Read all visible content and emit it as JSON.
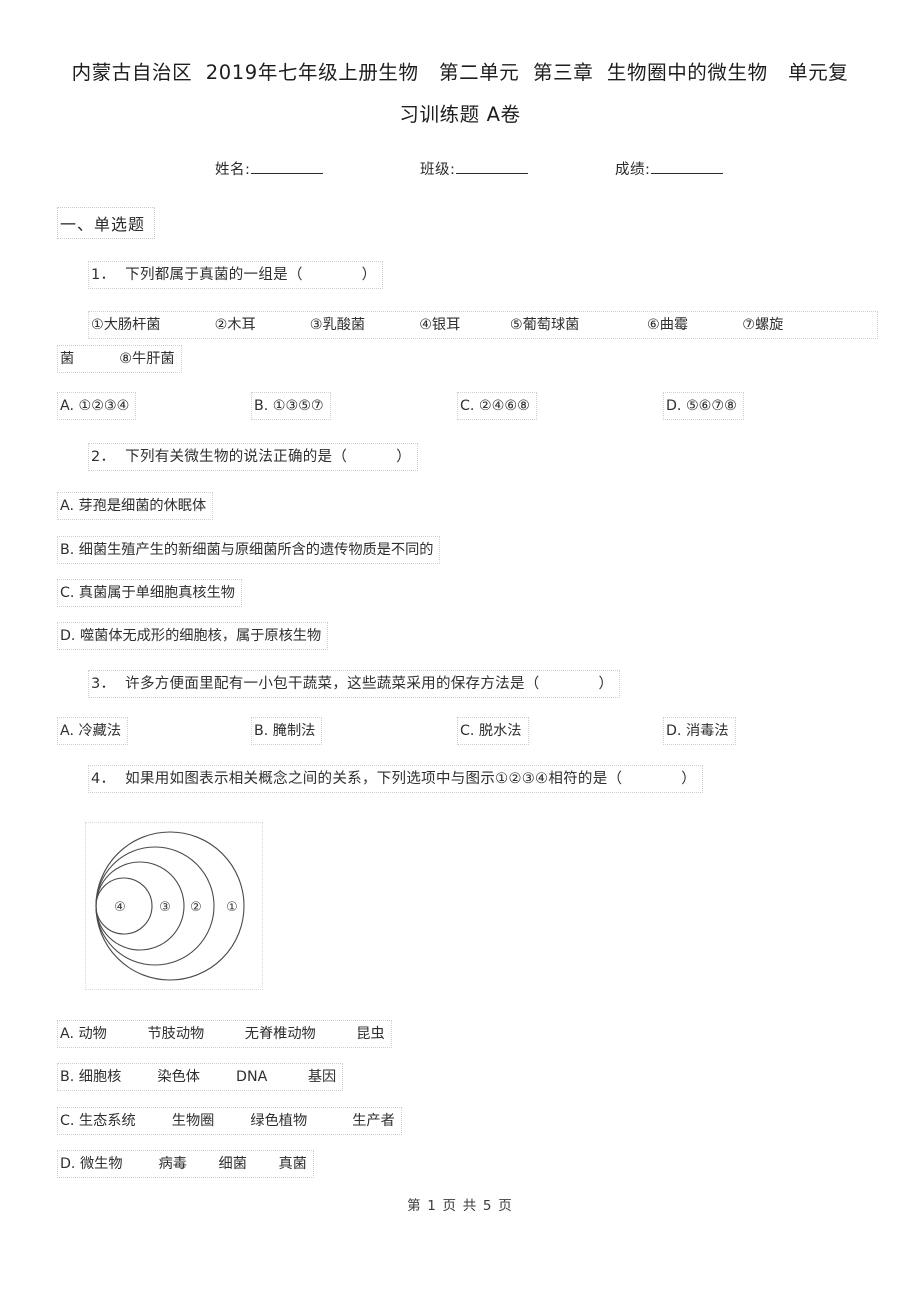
{
  "document": {
    "title_line1": "内蒙古自治区  2019年七年级上册生物   第二单元  第三章  生物圈中的微生物   单元复",
    "title_line2": "习训练题 A卷",
    "footer": "第 1 页 共 5 页"
  },
  "meta": {
    "name_label": "姓名:",
    "class_label": "班级:",
    "score_label": "成绩:"
  },
  "sections": [
    {
      "heading": "一、单选题"
    }
  ],
  "questions": [
    {
      "stem": "1．  下列都属于真菌的一组是（            ）",
      "list_line1": "①大肠杆菌            ②木耳            ③乳酸菌            ④银耳           ⑤葡萄球菌               ⑥曲霉            ⑦螺旋",
      "list_line2": "菌          ⑧牛肝菌",
      "options": [
        "A. ①②③④",
        "B. ①③⑤⑦",
        "C. ②④⑥⑧",
        "D. ⑤⑥⑦⑧"
      ]
    },
    {
      "stem": "2．  下列有关微生物的说法正确的是（          ）",
      "options": [
        "A. 芽孢是细菌的休眠体",
        "B. 细菌生殖产生的新细菌与原细菌所含的遗传物质是不同的",
        "C. 真菌属于单细胞真核生物",
        "D. 噬菌体无成形的细胞核，属于原核生物"
      ]
    },
    {
      "stem": "3．  许多方便面里配有一小包干蔬菜，这些蔬菜采用的保存方法是（            ）",
      "options": [
        "A. 冷藏法",
        "B. 腌制法",
        "C. 脱水法",
        "D. 消毒法"
      ]
    },
    {
      "stem": "4．  如果用如图表示相关概念之间的关系，下列选项中与图示①②③④相符的是（            ）",
      "figure": {
        "type": "nested-circles",
        "labels": [
          "①",
          "②",
          "③",
          "④"
        ],
        "description": "四个左侧相切的同心嵌套圆，由外到内依次标注①②③④"
      },
      "options": [
        "A. 动物         节肢动物         无脊椎动物         昆虫",
        "B. 细胞核        染色体        DNA         基因",
        "C. 生态系统        生物圈        绿色植物          生产者",
        "D. 微生物        病毒       细菌       真菌"
      ]
    }
  ]
}
